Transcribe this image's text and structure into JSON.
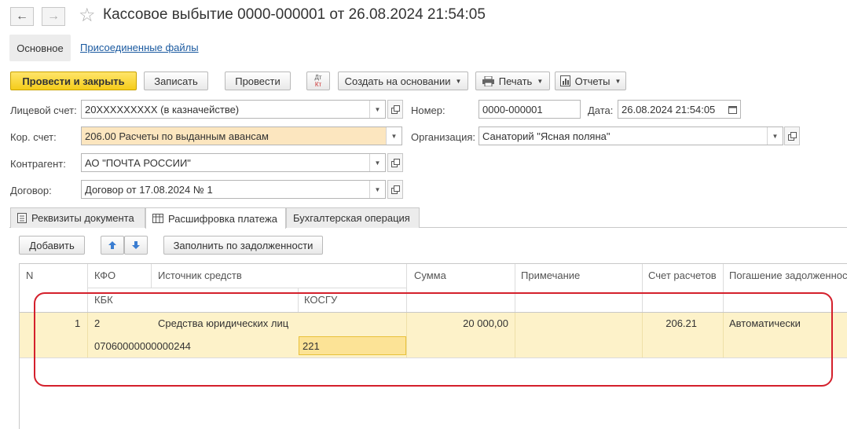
{
  "window": {
    "title": "Кассовое выбытие 0000-000001 от 26.08.2024 21:54:05"
  },
  "section_tabs": {
    "main": "Основное",
    "files": "Присоединенные файлы"
  },
  "toolbar": {
    "post_close": "Провести и закрыть",
    "save": "Записать",
    "post": "Провести",
    "dtkt_top": "Дт",
    "dtkt_bottom": "Кт",
    "create_based": "Создать на основании",
    "print": "Печать",
    "reports": "Отчеты"
  },
  "form": {
    "account_label": "Лицевой счет:",
    "account_value": "20XXXXXXXXX (в казначействе)",
    "number_label": "Номер:",
    "number_value": "0000-000001",
    "date_label": "Дата:",
    "date_value": "26.08.2024 21:54:05",
    "corr_label": "Кор. счет:",
    "corr_value": "206.00 Расчеты по выданным авансам",
    "org_label": "Организация:",
    "org_value": "Санаторий \"Ясная поляна\"",
    "contractor_label": "Контрагент:",
    "contractor_value": "АО \"ПОЧТА РОССИИ\"",
    "contract_label": "Договор:",
    "contract_value": "Договор от 17.08.2024 № 1"
  },
  "tabs": [
    {
      "label": "Реквизиты документа"
    },
    {
      "label": "Расшифровка платежа"
    },
    {
      "label": "Бухгалтерская операция"
    }
  ],
  "table_toolbar": {
    "add": "Добавить",
    "fill": "Заполнить по задолженности"
  },
  "table": {
    "headers": {
      "n": "N",
      "kfo": "КФО",
      "source": "Источник средств",
      "sum": "Сумма",
      "note": "Примечание",
      "account": "Счет расчетов",
      "repay": "Погашение задолженности",
      "kbk": "КБК",
      "kosgu": "КОСГУ"
    },
    "rows": [
      {
        "n": "1",
        "kfo": "2",
        "source": "Средства юридических лиц",
        "sum": "20 000,00",
        "note": "",
        "account": "206.21",
        "repay": "Автоматически",
        "kbk": "07060000000000244",
        "kosgu": "221"
      }
    ]
  },
  "colors": {
    "primary_button": "#f5cc1a",
    "highlight_field": "#fce6bf",
    "selected_row": "#fdf2c9",
    "annotation": "#d4202c",
    "link": "#1b5aa0"
  }
}
